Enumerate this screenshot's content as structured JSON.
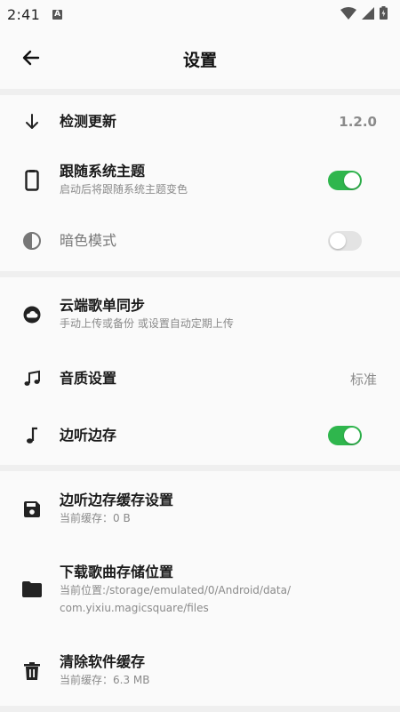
{
  "status_bar": {
    "time": "2:41",
    "notification_badge": "A"
  },
  "header": {
    "title": "设置"
  },
  "sections": [
    {
      "items": [
        {
          "icon": "arrow-down-icon",
          "title": "检测更新",
          "value": "1.2.0"
        },
        {
          "icon": "phone-icon",
          "title": "跟随系统主题",
          "subtitle": "启动后将跟随系统主题变色",
          "toggle": true
        },
        {
          "icon": "contrast-icon",
          "title": "暗色模式",
          "toggle": false
        }
      ]
    },
    {
      "items": [
        {
          "icon": "cloud-icon",
          "title": "云端歌单同步",
          "subtitle": "手动上传或备份 或设置自动定期上传"
        },
        {
          "icon": "music-notes-icon",
          "title": "音质设置",
          "value": "标准"
        },
        {
          "icon": "music-note-icon",
          "title": "边听边存",
          "toggle": true
        }
      ]
    },
    {
      "items": [
        {
          "icon": "save-icon",
          "title": "边听边存缓存设置",
          "subtitle": "当前缓存：0 B"
        },
        {
          "icon": "folder-icon",
          "title": "下载歌曲存储位置",
          "subtitle_lines": [
            "当前位置:/storage/emulated/0/Android/data/",
            "com.yixiu.magicsquare/files"
          ]
        },
        {
          "icon": "trash-icon",
          "title": "清除软件缓存",
          "subtitle": "当前缓存：6.3 MB"
        }
      ]
    }
  ],
  "colors": {
    "toggle_on": "#2fb64d",
    "toggle_off": "#e3e3e3",
    "divider": "#efefef",
    "background": "#fafafa"
  }
}
